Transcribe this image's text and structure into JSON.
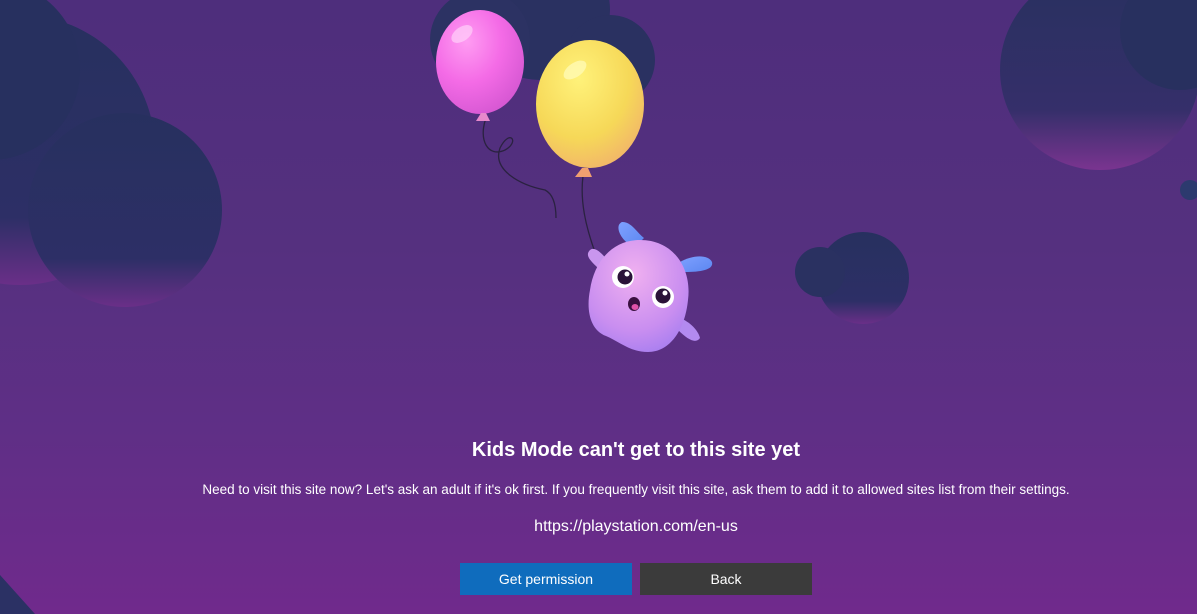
{
  "page": {
    "title": "Kids Mode can't get to this site yet",
    "description": "Need to visit this site now? Let's ask an adult if it's ok first. If you frequently visit this site, ask them to add it to allowed sites list from their settings.",
    "url": "https://playstation.com/en-us"
  },
  "buttons": {
    "get_permission_label": "Get permission",
    "back_label": "Back"
  },
  "colors": {
    "primary_button": "#0f6cbd",
    "secondary_button": "#3b3b3b",
    "background": "#55307f",
    "text": "#ffffff"
  },
  "icons": [
    "pink-balloon-icon",
    "yellow-balloon-icon",
    "kids-mascot-icon"
  ]
}
